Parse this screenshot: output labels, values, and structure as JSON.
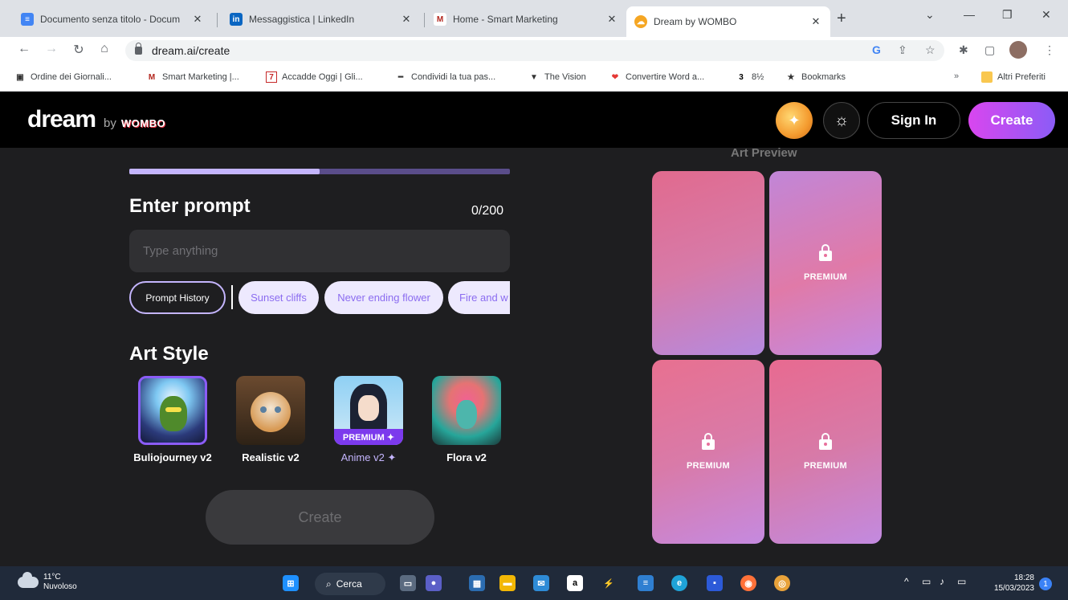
{
  "browser": {
    "tabs": [
      {
        "title": "Documento senza titolo - Docum",
        "icon": "google-docs-icon",
        "color": "#4285f4"
      },
      {
        "title": "Messaggistica | LinkedIn",
        "icon": "linkedin-icon",
        "color": "#0a66c2"
      },
      {
        "title": "Home - Smart Marketing",
        "icon": "smart-marketing-icon",
        "color": "#b3261e"
      },
      {
        "title": "Dream by WOMBO",
        "icon": "wombo-icon",
        "color": "#f5a623"
      }
    ],
    "url": "dream.ai/create",
    "bookmarks": [
      "Ordine dei Giornali...",
      "Smart Marketing |...",
      "Accadde Oggi | Gli...",
      "Condividi la tua pas...",
      "The Vision",
      "Convertire Word a...",
      "8½",
      "Bookmarks"
    ],
    "other_bookmarks": "Altri Preferiti",
    "overflow": "»"
  },
  "app": {
    "logo": "dream",
    "by": "by",
    "brand": "WOMBO",
    "sign_in": "Sign In",
    "create_top": "Create"
  },
  "prompt": {
    "progress_fraction": 0.5,
    "heading": "Enter prompt",
    "count": "0/200",
    "placeholder": "Type anything",
    "history_chip": "Prompt History",
    "suggestions": [
      "Sunset cliffs",
      "Never ending flower",
      "Fire and w"
    ]
  },
  "art_style": {
    "heading": "Art Style",
    "styles": [
      {
        "label": "Buliojourney v2",
        "premium": false,
        "selected": true
      },
      {
        "label": "Realistic v2",
        "premium": false,
        "selected": false
      },
      {
        "label": "Anime v2 ✦",
        "premium": true,
        "badge": "PREMIUM ✦",
        "selected": false
      },
      {
        "label": "Flora v2",
        "premium": false,
        "selected": false
      }
    ],
    "create_button": "Create"
  },
  "preview": {
    "title": "Art Preview",
    "cards": [
      {
        "locked": false,
        "label": ""
      },
      {
        "locked": true,
        "label": "PREMIUM"
      },
      {
        "locked": true,
        "label": "PREMIUM"
      },
      {
        "locked": true,
        "label": "PREMIUM"
      }
    ]
  },
  "taskbar": {
    "temperature": "11°C",
    "condition": "Nuvoloso",
    "search": "Cerca",
    "time": "18:28",
    "date": "15/03/2023",
    "notifications": "1"
  }
}
